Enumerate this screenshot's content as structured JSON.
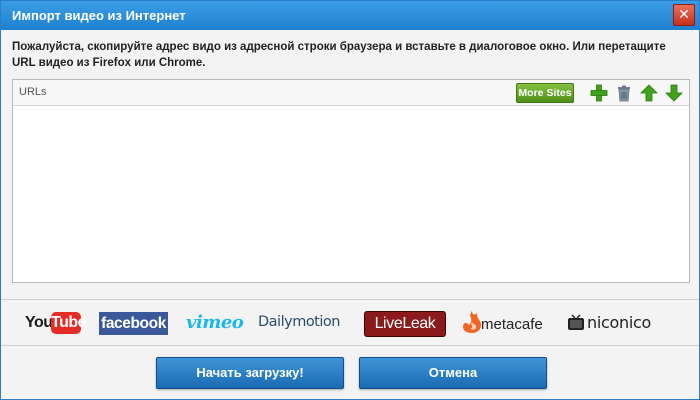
{
  "window": {
    "title": "Импорт видео из Интернет",
    "close_icon": "close-icon"
  },
  "instructions": "Пожалуйста, скопируйте адрес видо из адресной строки браузера и вставьте в диалоговое окно. Или перетащите URL видео из Firefox или Chrome.",
  "urls_panel": {
    "label": "URLs",
    "more_sites_label": "More Sites",
    "tools": [
      "add-icon",
      "trash-icon",
      "arrow-up-icon",
      "arrow-down-icon"
    ],
    "items": []
  },
  "sites": {
    "youtube_you": "You",
    "youtube_tube": "Tube",
    "facebook": "facebook",
    "vimeo": "vimeo",
    "dailymotion": "Dailymotion",
    "liveleak": "LiveLeak",
    "metacafe": "metacafe",
    "niconico": "niconico"
  },
  "buttons": {
    "start": "Начать загрузку!",
    "cancel": "Отмена"
  },
  "colors": {
    "title_bar": "#2b8ad9",
    "button": "#2a7fc4",
    "more_sites": "#6aa82e",
    "close": "#d8472f",
    "youtube_red": "#e52d27",
    "facebook_blue": "#3b5998",
    "vimeo_blue": "#1ab7ea",
    "liveleak_red": "#8b1a1a",
    "metacafe_orange": "#f26522"
  }
}
